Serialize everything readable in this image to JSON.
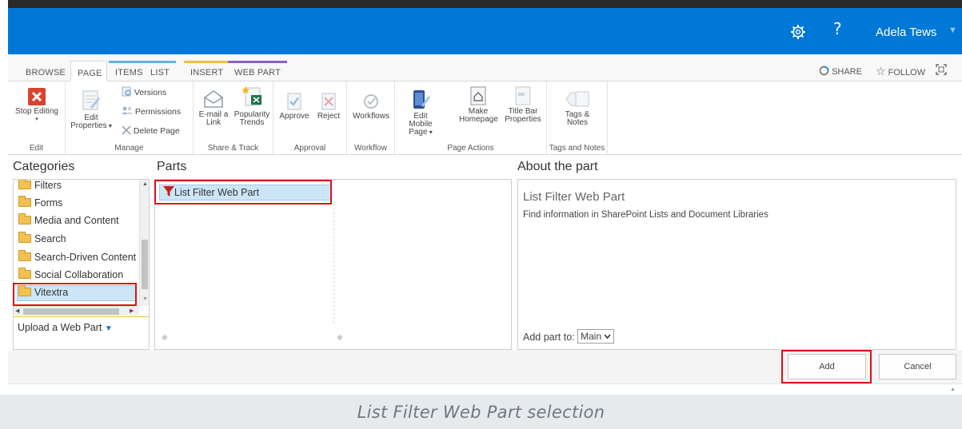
{
  "suite_bar": {
    "help_glyph": "?",
    "user_name": "Adela Tews",
    "user_caret": "▼"
  },
  "ribbon": {
    "tabs": [
      "BROWSE",
      "PAGE",
      "ITEMS",
      "LIST",
      "INSERT",
      "WEB PART"
    ],
    "share_label": "SHARE",
    "follow_label": "FOLLOW",
    "groups": {
      "edit": {
        "label": "Edit",
        "stop_editing": "Stop Editing"
      },
      "manage": {
        "label": "Manage",
        "edit_properties_line1": "Edit",
        "edit_properties_line2": "Properties",
        "versions": "Versions",
        "permissions": "Permissions",
        "delete_page": "Delete Page"
      },
      "share_track": {
        "label": "Share & Track",
        "email_link_line1": "E-mail a",
        "email_link_line2": "Link",
        "popularity_line1": "Popularity",
        "popularity_line2": "Trends"
      },
      "approval": {
        "label": "Approval",
        "approve": "Approve",
        "reject": "Reject"
      },
      "workflow": {
        "label": "Workflow",
        "workflows": "Workflows"
      },
      "page_actions": {
        "label": "Page Actions",
        "edit_mobile_line1": "Edit Mobile",
        "edit_mobile_line2": "Page",
        "make_homepage_line1": "Make",
        "make_homepage_line2": "Homepage",
        "title_bar_line1": "Title Bar",
        "title_bar_line2": "Properties"
      },
      "tags_notes": {
        "label": "Tags and Notes",
        "tags_line1": "Tags &",
        "tags_line2": "Notes"
      }
    }
  },
  "categories": {
    "header": "Categories",
    "items": [
      "Filters",
      "Forms",
      "Media and Content",
      "Search",
      "Search-Driven Content",
      "Social Collaboration",
      "Vitextra"
    ],
    "upload_label": "Upload a Web Part"
  },
  "parts": {
    "header": "Parts",
    "items": [
      "List Filter Web Part"
    ]
  },
  "about": {
    "header": "About the part",
    "title": "List Filter Web Part",
    "description": "Find information in SharePoint Lists and Document Libraries",
    "add_part_to_label": "Add part to:",
    "zone_selected": "Main"
  },
  "buttons": {
    "add": "Add",
    "cancel": "Cancel"
  },
  "caption": "List Filter Web Part selection",
  "colors": {
    "suite_bar": "#0078d7",
    "highlight_box": "#e01010",
    "selection": "#cde6f7"
  }
}
